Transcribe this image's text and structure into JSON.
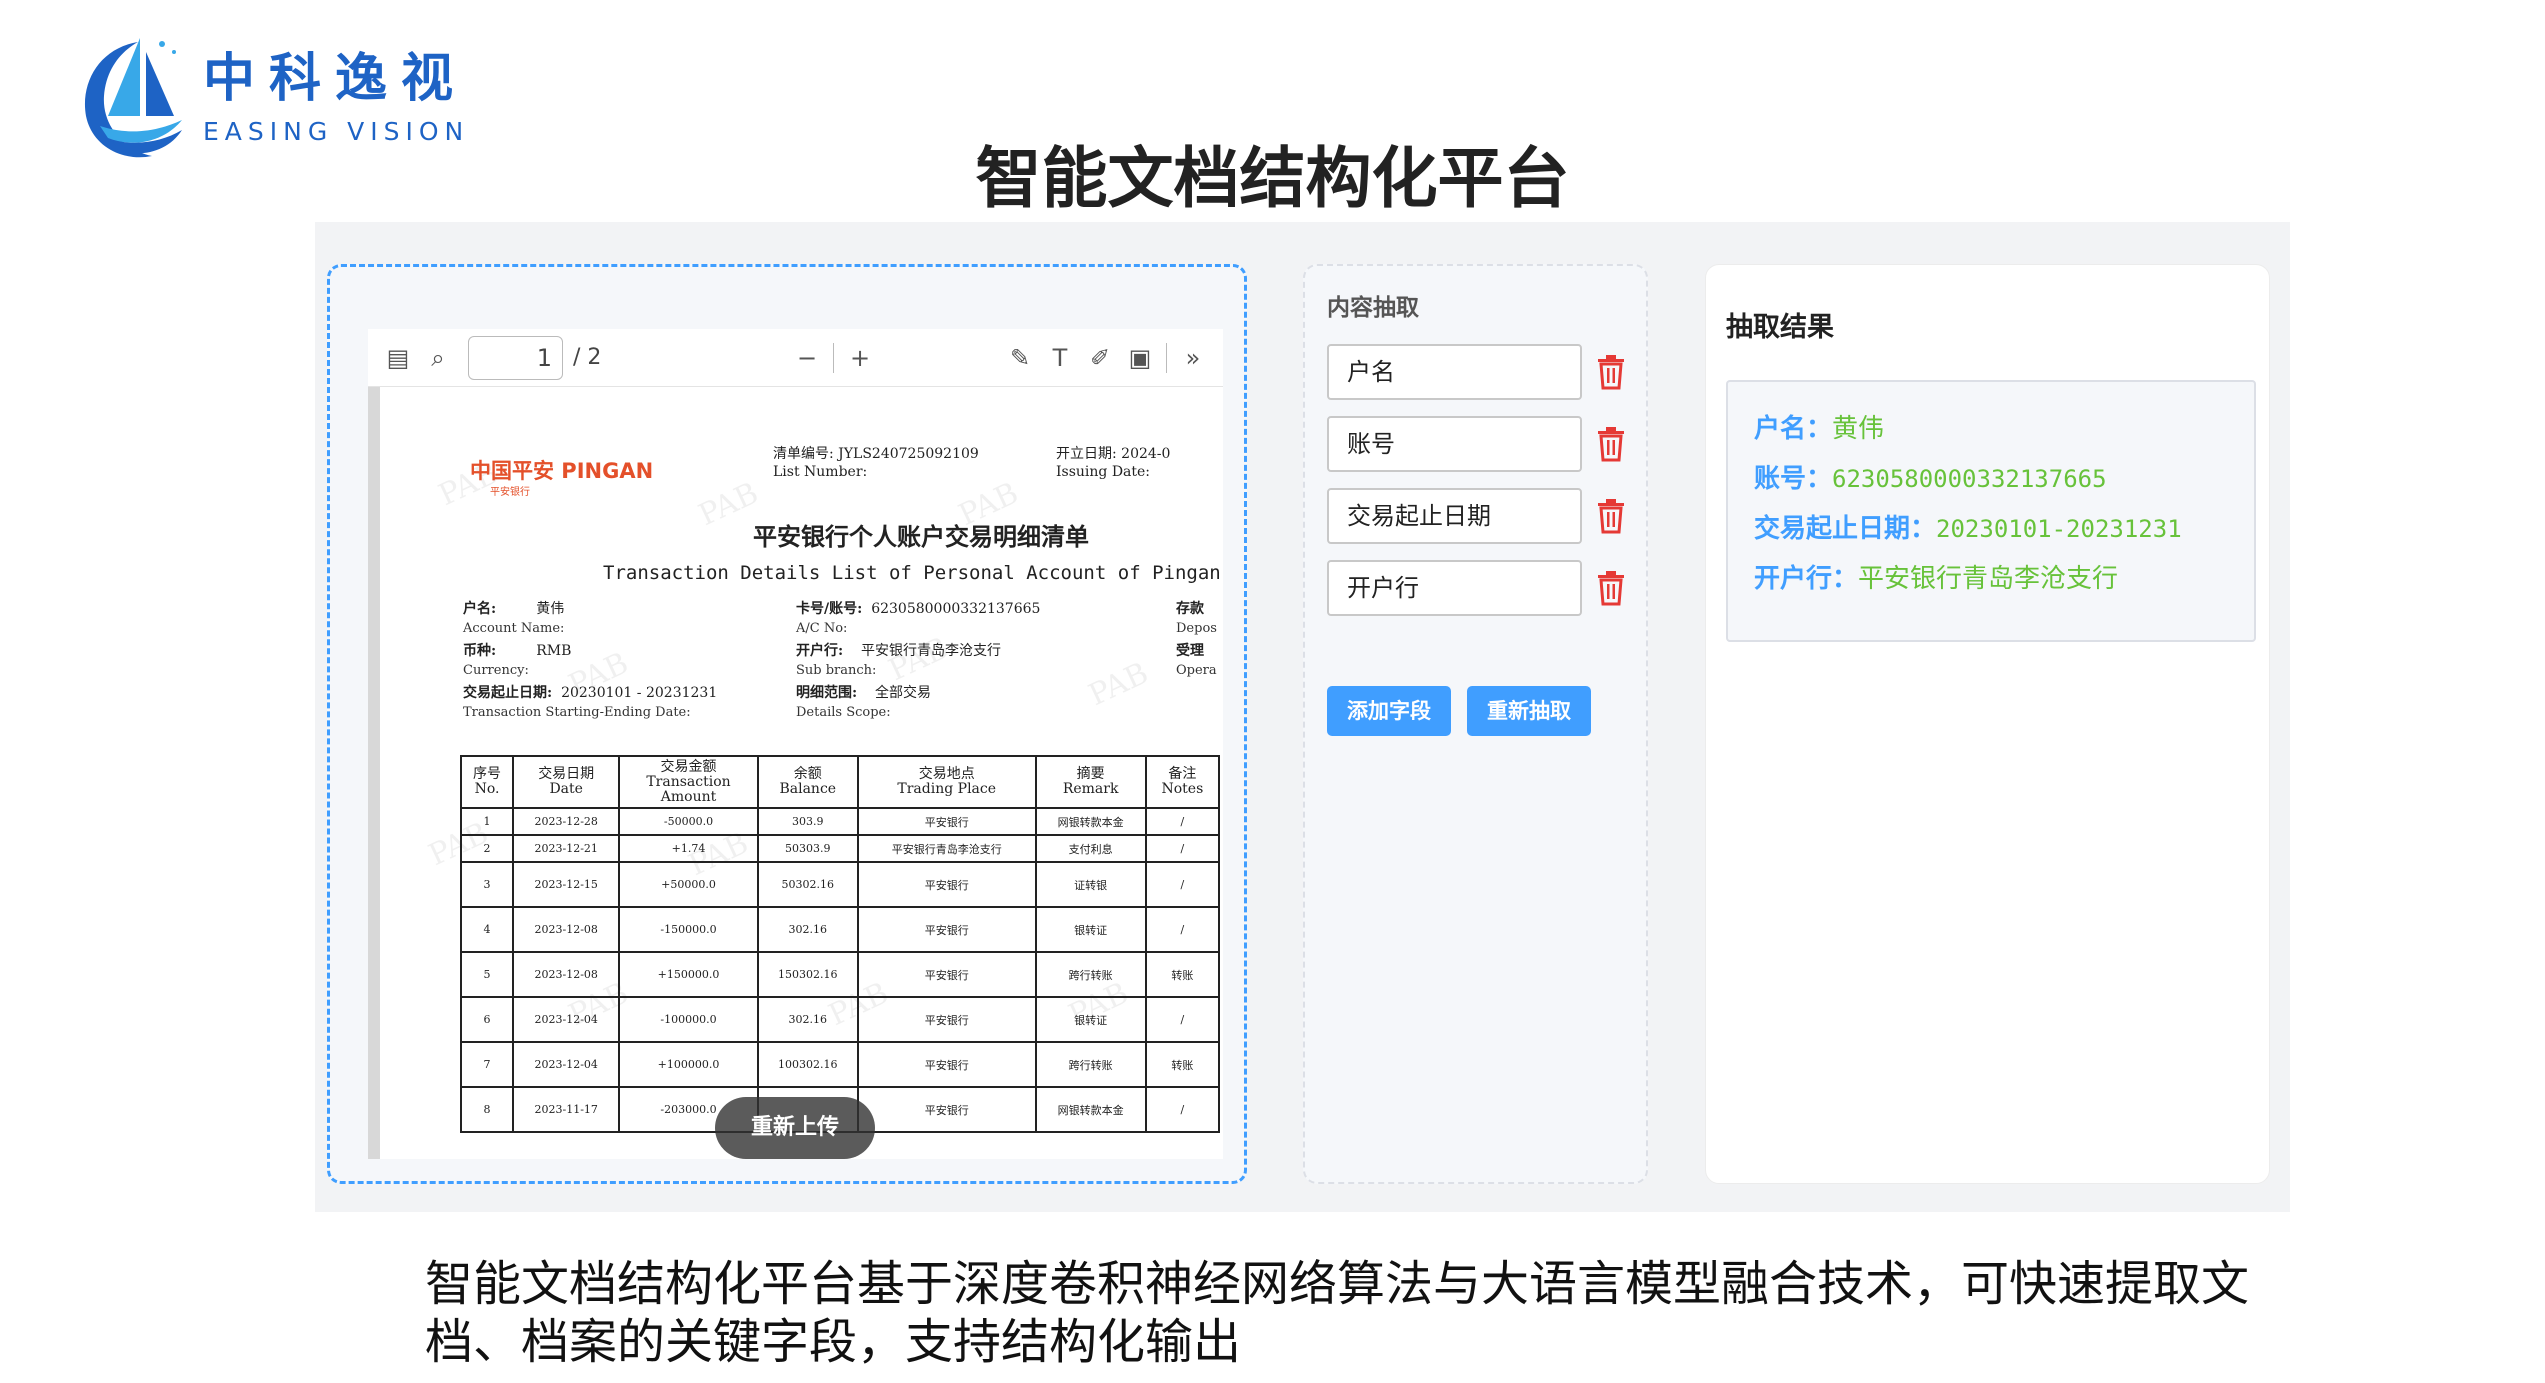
{
  "logo": {
    "cn": "中科逸视",
    "en": "EASING VISION",
    "colors": {
      "primary": "#1e63c5",
      "accent": "#38a8e8"
    }
  },
  "page_title": "智能文档结构化平台",
  "viewer": {
    "page_current": "1",
    "page_total": "/ 2",
    "icons": [
      "sidebar-icon",
      "search-icon",
      "zoom-out-icon",
      "zoom-in-icon",
      "highlight-icon",
      "text-icon",
      "draw-icon",
      "image-icon",
      "more-icon"
    ],
    "reupload_label": "重新上传"
  },
  "document": {
    "bank_logo": "中国平安 PINGAN",
    "bank_logo_sub": "平安银行",
    "watermark": "PAB",
    "meta_lines": [
      "清单编号:  JYLS240725092109",
      "List Number:",
      "开立日期:  2024-0",
      "Issuing Date:"
    ],
    "title": "平安银行个人账户交易明细清单",
    "subtitle": "Transaction Details List of Personal Account of Pingan B",
    "info": {
      "name_label": "户名:",
      "name_en": "Account Name:",
      "name_value": "黄伟",
      "currency_label": "币种:",
      "currency_en": "Currency:",
      "currency_value": "RMB",
      "date_label": "交易起止日期:",
      "date_en": "Transaction Starting-Ending Date:",
      "date_value": "20230101 - 20231231",
      "card_label": "卡号/账号:",
      "card_en": "A/C No:",
      "card_value": "6230580000332137665",
      "branch_label": "开户行:",
      "branch_en": "Sub branch:",
      "branch_value": "平安银行青岛李沧支行",
      "scope_label": "明细范围:",
      "scope_en": "Details Scope:",
      "scope_value": "全部交易",
      "right_col_1": "存款",
      "right_col_1_en": "Depos",
      "right_col_2": "受理",
      "right_col_2_en": "Opera"
    },
    "table": {
      "headers": [
        [
          "序号",
          "No."
        ],
        [
          "交易日期",
          "Date"
        ],
        [
          "交易金额",
          "Transaction",
          "Amount"
        ],
        [
          "余额",
          "Balance"
        ],
        [
          "交易地点",
          "Trading Place"
        ],
        [
          "摘要",
          "Remark"
        ],
        [
          "备注",
          "Notes"
        ]
      ],
      "rows": [
        [
          "1",
          "2023-12-28",
          "-50000.0",
          "303.9",
          "平安银行",
          "网银转款本金",
          "/"
        ],
        [
          "2",
          "2023-12-21",
          "+1.74",
          "50303.9",
          "平安银行青岛李沧支行",
          "支付利息",
          "/"
        ],
        [
          "3",
          "2023-12-15",
          "+50000.0",
          "50302.16",
          "平安银行",
          "证转银",
          "/"
        ],
        [
          "4",
          "2023-12-08",
          "-150000.0",
          "302.16",
          "平安银行",
          "银转证",
          "/"
        ],
        [
          "5",
          "2023-12-08",
          "+150000.0",
          "150302.16",
          "平安银行",
          "跨行转账",
          "转账"
        ],
        [
          "6",
          "2023-12-04",
          "-100000.0",
          "302.16",
          "平安银行",
          "银转证",
          "/"
        ],
        [
          "7",
          "2023-12-04",
          "+100000.0",
          "100302.16",
          "平安银行",
          "跨行转账",
          "转账"
        ],
        [
          "8",
          "2023-11-17",
          "-203000.0",
          "",
          "平安银行",
          "网银转款本金",
          "/"
        ]
      ]
    }
  },
  "config": {
    "title": "内容抽取",
    "fields": [
      "户名",
      "账号",
      "交易起止日期",
      "开户行"
    ],
    "add_button": "添加字段",
    "reextract_button": "重新抽取"
  },
  "results": {
    "title": "抽取结果",
    "items": [
      {
        "key": "户名：",
        "value": "黄伟"
      },
      {
        "key": "账号：",
        "value": "6230580000332137665"
      },
      {
        "key": "交易起止日期：",
        "value": "20230101-20231231"
      },
      {
        "key": "开户行：",
        "value": "平安银行青岛李沧支行"
      }
    ],
    "colors": {
      "key": "#409eff",
      "value": "#67c23a"
    }
  },
  "caption": "智能文档结构化平台基于深度卷积神经网络算法与大语言模型融合技术，可快速提取文档、档案的关键字段，支持结构化输出"
}
